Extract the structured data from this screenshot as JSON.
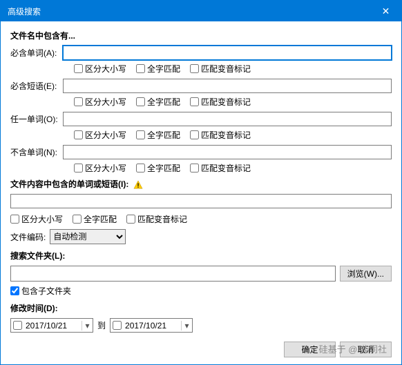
{
  "title": "高级搜索",
  "close_glyph": "✕",
  "filename": {
    "heading": "文件名中包含有...",
    "all_words_label": "必含单词(A):",
    "phrase_label": "必含短语(E):",
    "any_words_label": "任一单词(O):",
    "none_words_label": "不含单词(N):",
    "all_words_value": "",
    "phrase_value": "",
    "any_words_value": "",
    "none_words_value": ""
  },
  "checks": {
    "case": "区分大小写",
    "whole": "全字匹配",
    "diacritics": "匹配变音标记"
  },
  "content": {
    "heading": "文件内容中包含的单词或短语(I):",
    "value": "",
    "encoding_label": "文件编码:",
    "encoding_value": "自动检测"
  },
  "folder": {
    "heading": "搜索文件夹(L):",
    "value": "",
    "browse": "浏览(W)...",
    "subfolders": "包含子文件夹"
  },
  "dates": {
    "heading": "修改时间(D):",
    "from": "2017/10/21",
    "to_label": "到",
    "to": "2017/10/21"
  },
  "buttons": {
    "ok": "确定",
    "cancel": "取消"
  },
  "watermark": "硅基于 @ 非同社"
}
